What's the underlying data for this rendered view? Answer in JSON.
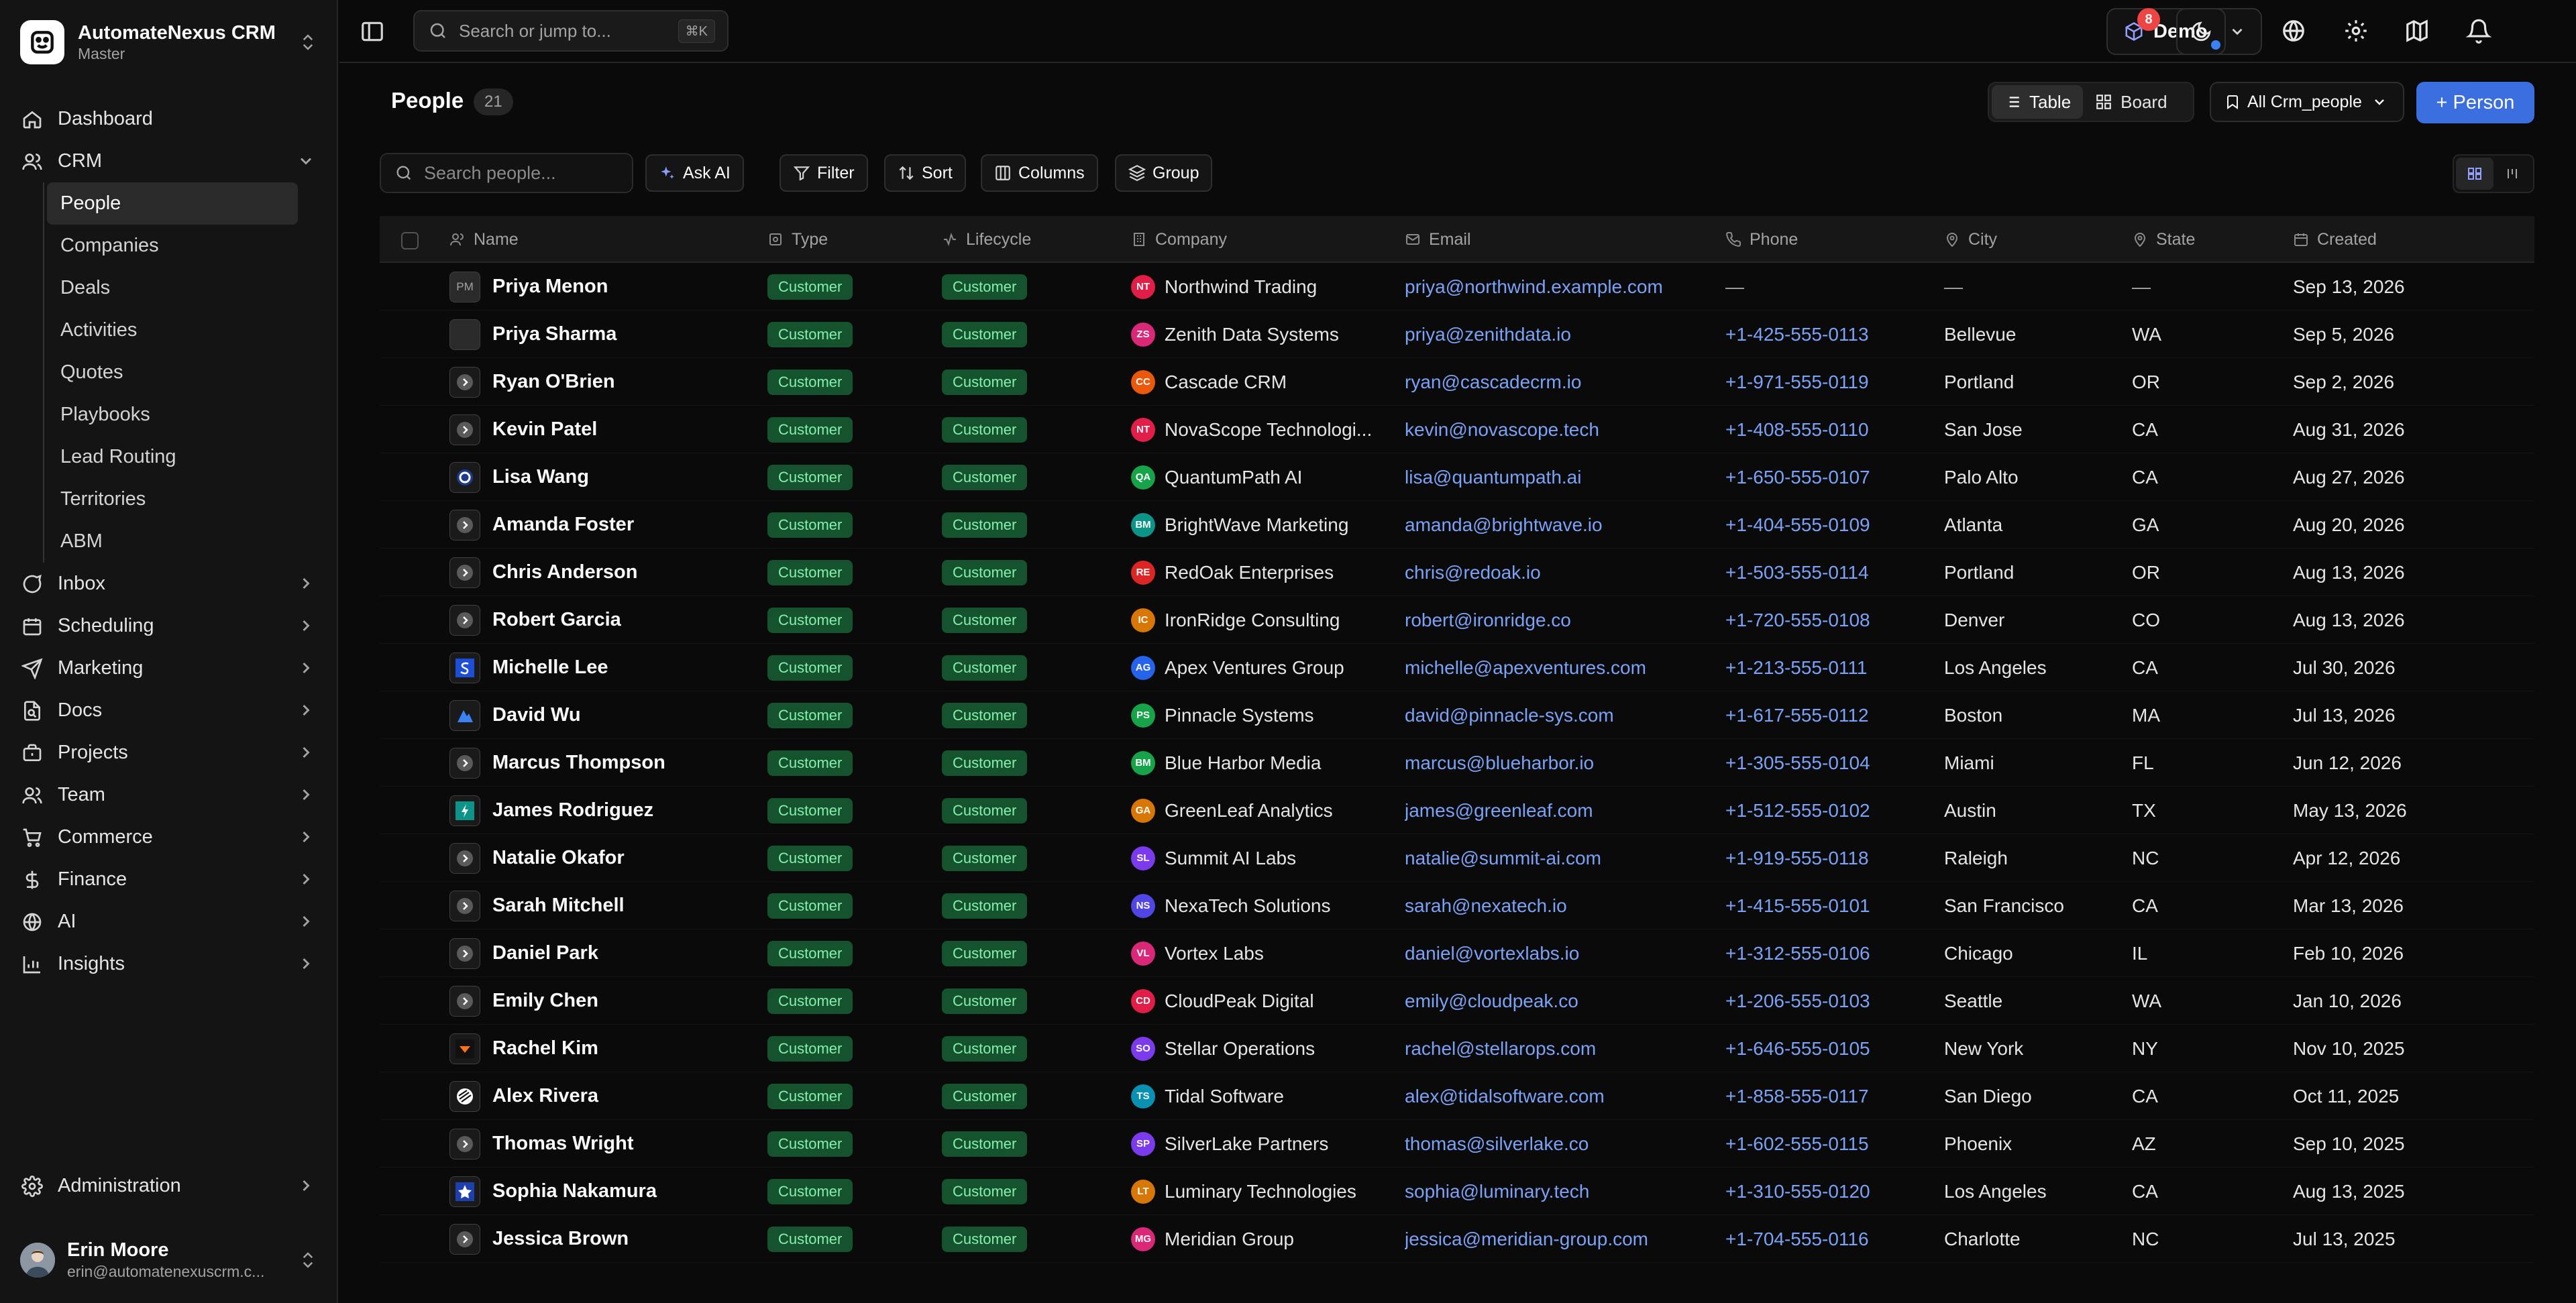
{
  "workspace": {
    "name": "AutomateNexus CRM",
    "sub": "Master"
  },
  "nav": {
    "dashboard": "Dashboard",
    "crm": "CRM",
    "crm_items": [
      "People",
      "Companies",
      "Deals",
      "Activities",
      "Quotes",
      "Playbooks",
      "Lead Routing",
      "Territories",
      "ABM"
    ],
    "sections": [
      "Inbox",
      "Scheduling",
      "Marketing",
      "Docs",
      "Projects",
      "Team",
      "Commerce",
      "Finance",
      "AI",
      "Insights"
    ],
    "administration": "Administration"
  },
  "user": {
    "name": "Erin Moore",
    "email": "erin@automatenexuscrm.c..."
  },
  "topbar": {
    "search_placeholder": "Search or jump to...",
    "shortcut": "⌘K",
    "env": "Demo",
    "notifications": "8"
  },
  "page": {
    "title": "People",
    "count": "21",
    "view_table": "Table",
    "view_board": "Board",
    "saved_view": "All Crm_people",
    "add_button": "+ Person"
  },
  "toolbar": {
    "search_placeholder": "Search people...",
    "ask_ai": "Ask AI",
    "filter": "Filter",
    "sort": "Sort",
    "columns": "Columns",
    "group": "Group"
  },
  "columns": [
    "Name",
    "Type",
    "Lifecycle",
    "Company",
    "Email",
    "Phone",
    "City",
    "State",
    "Created"
  ],
  "rows": [
    {
      "name": "Priya Menon",
      "initials": "PM",
      "avatar": "initials",
      "type": "Customer",
      "lifecycle": "Customer",
      "company": "Northwind Trading",
      "cinit": "NT",
      "ccolor": "#e11d48",
      "email": "priya@northwind.example.com",
      "phone": "—",
      "city": "—",
      "state": "—",
      "created": "Sep 13, 2026"
    },
    {
      "name": "Priya Sharma",
      "initials": "",
      "avatar": "blank",
      "type": "Customer",
      "lifecycle": "Customer",
      "company": "Zenith Data Systems",
      "cinit": "ZS",
      "ccolor": "#db2777",
      "email": "priya@zenithdata.io",
      "phone": "+1-425-555-0113",
      "city": "Bellevue",
      "state": "WA",
      "created": "Sep 5, 2026"
    },
    {
      "name": "Ryan O'Brien",
      "initials": "",
      "avatar": "chevron",
      "type": "Customer",
      "lifecycle": "Customer",
      "company": "Cascade CRM",
      "cinit": "CC",
      "ccolor": "#ea580c",
      "email": "ryan@cascadecrm.io",
      "phone": "+1-971-555-0119",
      "city": "Portland",
      "state": "OR",
      "created": "Sep 2, 2026"
    },
    {
      "name": "Kevin Patel",
      "initials": "",
      "avatar": "chevron",
      "type": "Customer",
      "lifecycle": "Customer",
      "company": "NovaScope Technologi...",
      "cinit": "NT",
      "ccolor": "#e11d48",
      "email": "kevin@novascope.tech",
      "phone": "+1-408-555-0110",
      "city": "San Jose",
      "state": "CA",
      "created": "Aug 31, 2026"
    },
    {
      "name": "Lisa Wang",
      "initials": "",
      "avatar": "ring",
      "type": "Customer",
      "lifecycle": "Customer",
      "company": "QuantumPath AI",
      "cinit": "QA",
      "ccolor": "#16a34a",
      "email": "lisa@quantumpath.ai",
      "phone": "+1-650-555-0107",
      "city": "Palo Alto",
      "state": "CA",
      "created": "Aug 27, 2026"
    },
    {
      "name": "Amanda Foster",
      "initials": "",
      "avatar": "chevron",
      "type": "Customer",
      "lifecycle": "Customer",
      "company": "BrightWave Marketing",
      "cinit": "BM",
      "ccolor": "#0d9488",
      "email": "amanda@brightwave.io",
      "phone": "+1-404-555-0109",
      "city": "Atlanta",
      "state": "GA",
      "created": "Aug 20, 2026"
    },
    {
      "name": "Chris Anderson",
      "initials": "",
      "avatar": "chevron",
      "type": "Customer",
      "lifecycle": "Customer",
      "company": "RedOak Enterprises",
      "cinit": "RE",
      "ccolor": "#dc2626",
      "email": "chris@redoak.io",
      "phone": "+1-503-555-0114",
      "city": "Portland",
      "state": "OR",
      "created": "Aug 13, 2026"
    },
    {
      "name": "Robert Garcia",
      "initials": "",
      "avatar": "chevron",
      "type": "Customer",
      "lifecycle": "Customer",
      "company": "IronRidge Consulting",
      "cinit": "IC",
      "ccolor": "#d97706",
      "email": "robert@ironridge.co",
      "phone": "+1-720-555-0108",
      "city": "Denver",
      "state": "CO",
      "created": "Aug 13, 2026"
    },
    {
      "name": "Michelle Lee",
      "initials": "",
      "avatar": "blue-s",
      "type": "Customer",
      "lifecycle": "Customer",
      "company": "Apex Ventures Group",
      "cinit": "AG",
      "ccolor": "#2563eb",
      "email": "michelle@apexventures.com",
      "phone": "+1-213-555-0111",
      "city": "Los Angeles",
      "state": "CA",
      "created": "Jul 30, 2026"
    },
    {
      "name": "David Wu",
      "initials": "",
      "avatar": "mountain",
      "type": "Customer",
      "lifecycle": "Customer",
      "company": "Pinnacle Systems",
      "cinit": "PS",
      "ccolor": "#16a34a",
      "email": "david@pinnacle-sys.com",
      "phone": "+1-617-555-0112",
      "city": "Boston",
      "state": "MA",
      "created": "Jul 13, 2026"
    },
    {
      "name": "Marcus Thompson",
      "initials": "",
      "avatar": "chevron",
      "type": "Customer",
      "lifecycle": "Customer",
      "company": "Blue Harbor Media",
      "cinit": "BM",
      "ccolor": "#16a34a",
      "email": "marcus@blueharbor.io",
      "phone": "+1-305-555-0104",
      "city": "Miami",
      "state": "FL",
      "created": "Jun 12, 2026"
    },
    {
      "name": "James Rodriguez",
      "initials": "",
      "avatar": "teal-bolt",
      "type": "Customer",
      "lifecycle": "Customer",
      "company": "GreenLeaf Analytics",
      "cinit": "GA",
      "ccolor": "#d97706",
      "email": "james@greenleaf.com",
      "phone": "+1-512-555-0102",
      "city": "Austin",
      "state": "TX",
      "created": "May 13, 2026"
    },
    {
      "name": "Natalie Okafor",
      "initials": "",
      "avatar": "chevron",
      "type": "Customer",
      "lifecycle": "Customer",
      "company": "Summit AI Labs",
      "cinit": "SL",
      "ccolor": "#7c3aed",
      "email": "natalie@summit-ai.com",
      "phone": "+1-919-555-0118",
      "city": "Raleigh",
      "state": "NC",
      "created": "Apr 12, 2026"
    },
    {
      "name": "Sarah Mitchell",
      "initials": "",
      "avatar": "chevron",
      "type": "Customer",
      "lifecycle": "Customer",
      "company": "NexaTech Solutions",
      "cinit": "NS",
      "ccolor": "#4f46e5",
      "email": "sarah@nexatech.io",
      "phone": "+1-415-555-0101",
      "city": "San Francisco",
      "state": "CA",
      "created": "Mar 13, 2026"
    },
    {
      "name": "Daniel Park",
      "initials": "",
      "avatar": "chevron",
      "type": "Customer",
      "lifecycle": "Customer",
      "company": "Vortex Labs",
      "cinit": "VL",
      "ccolor": "#db2777",
      "email": "daniel@vortexlabs.io",
      "phone": "+1-312-555-0106",
      "city": "Chicago",
      "state": "IL",
      "created": "Feb 10, 2026"
    },
    {
      "name": "Emily Chen",
      "initials": "",
      "avatar": "chevron",
      "type": "Customer",
      "lifecycle": "Customer",
      "company": "CloudPeak Digital",
      "cinit": "CD",
      "ccolor": "#e11d48",
      "email": "emily@cloudpeak.co",
      "phone": "+1-206-555-0103",
      "city": "Seattle",
      "state": "WA",
      "created": "Jan 10, 2026"
    },
    {
      "name": "Rachel Kim",
      "initials": "",
      "avatar": "orange-mark",
      "type": "Customer",
      "lifecycle": "Customer",
      "company": "Stellar Operations",
      "cinit": "SO",
      "ccolor": "#7c3aed",
      "email": "rachel@stellarops.com",
      "phone": "+1-646-555-0105",
      "city": "New York",
      "state": "NY",
      "created": "Nov 10, 2025"
    },
    {
      "name": "Alex Rivera",
      "initials": "",
      "avatar": "stripes",
      "type": "Customer",
      "lifecycle": "Customer",
      "company": "Tidal Software",
      "cinit": "TS",
      "ccolor": "#0891b2",
      "email": "alex@tidalsoftware.com",
      "phone": "+1-858-555-0117",
      "city": "San Diego",
      "state": "CA",
      "created": "Oct 11, 2025"
    },
    {
      "name": "Thomas Wright",
      "initials": "",
      "avatar": "chevron",
      "type": "Customer",
      "lifecycle": "Customer",
      "company": "SilverLake Partners",
      "cinit": "SP",
      "ccolor": "#7c3aed",
      "email": "thomas@silverlake.co",
      "phone": "+1-602-555-0115",
      "city": "Phoenix",
      "state": "AZ",
      "created": "Sep 10, 2025"
    },
    {
      "name": "Sophia Nakamura",
      "initials": "",
      "avatar": "star",
      "type": "Customer",
      "lifecycle": "Customer",
      "company": "Luminary Technologies",
      "cinit": "LT",
      "ccolor": "#d97706",
      "email": "sophia@luminary.tech",
      "phone": "+1-310-555-0120",
      "city": "Los Angeles",
      "state": "CA",
      "created": "Aug 13, 2025"
    },
    {
      "name": "Jessica Brown",
      "initials": "",
      "avatar": "chevron",
      "type": "Customer",
      "lifecycle": "Customer",
      "company": "Meridian Group",
      "cinit": "MG",
      "ccolor": "#db2777",
      "email": "jessica@meridian-group.com",
      "phone": "+1-704-555-0116",
      "city": "Charlotte",
      "state": "NC",
      "created": "Jul 13, 2025"
    }
  ],
  "colors": {
    "accent": "#3b6fe0",
    "pill_bg": "#14532d",
    "pill_fg": "#86efac",
    "link": "#7aa2f7",
    "badge": "#ef4444"
  }
}
